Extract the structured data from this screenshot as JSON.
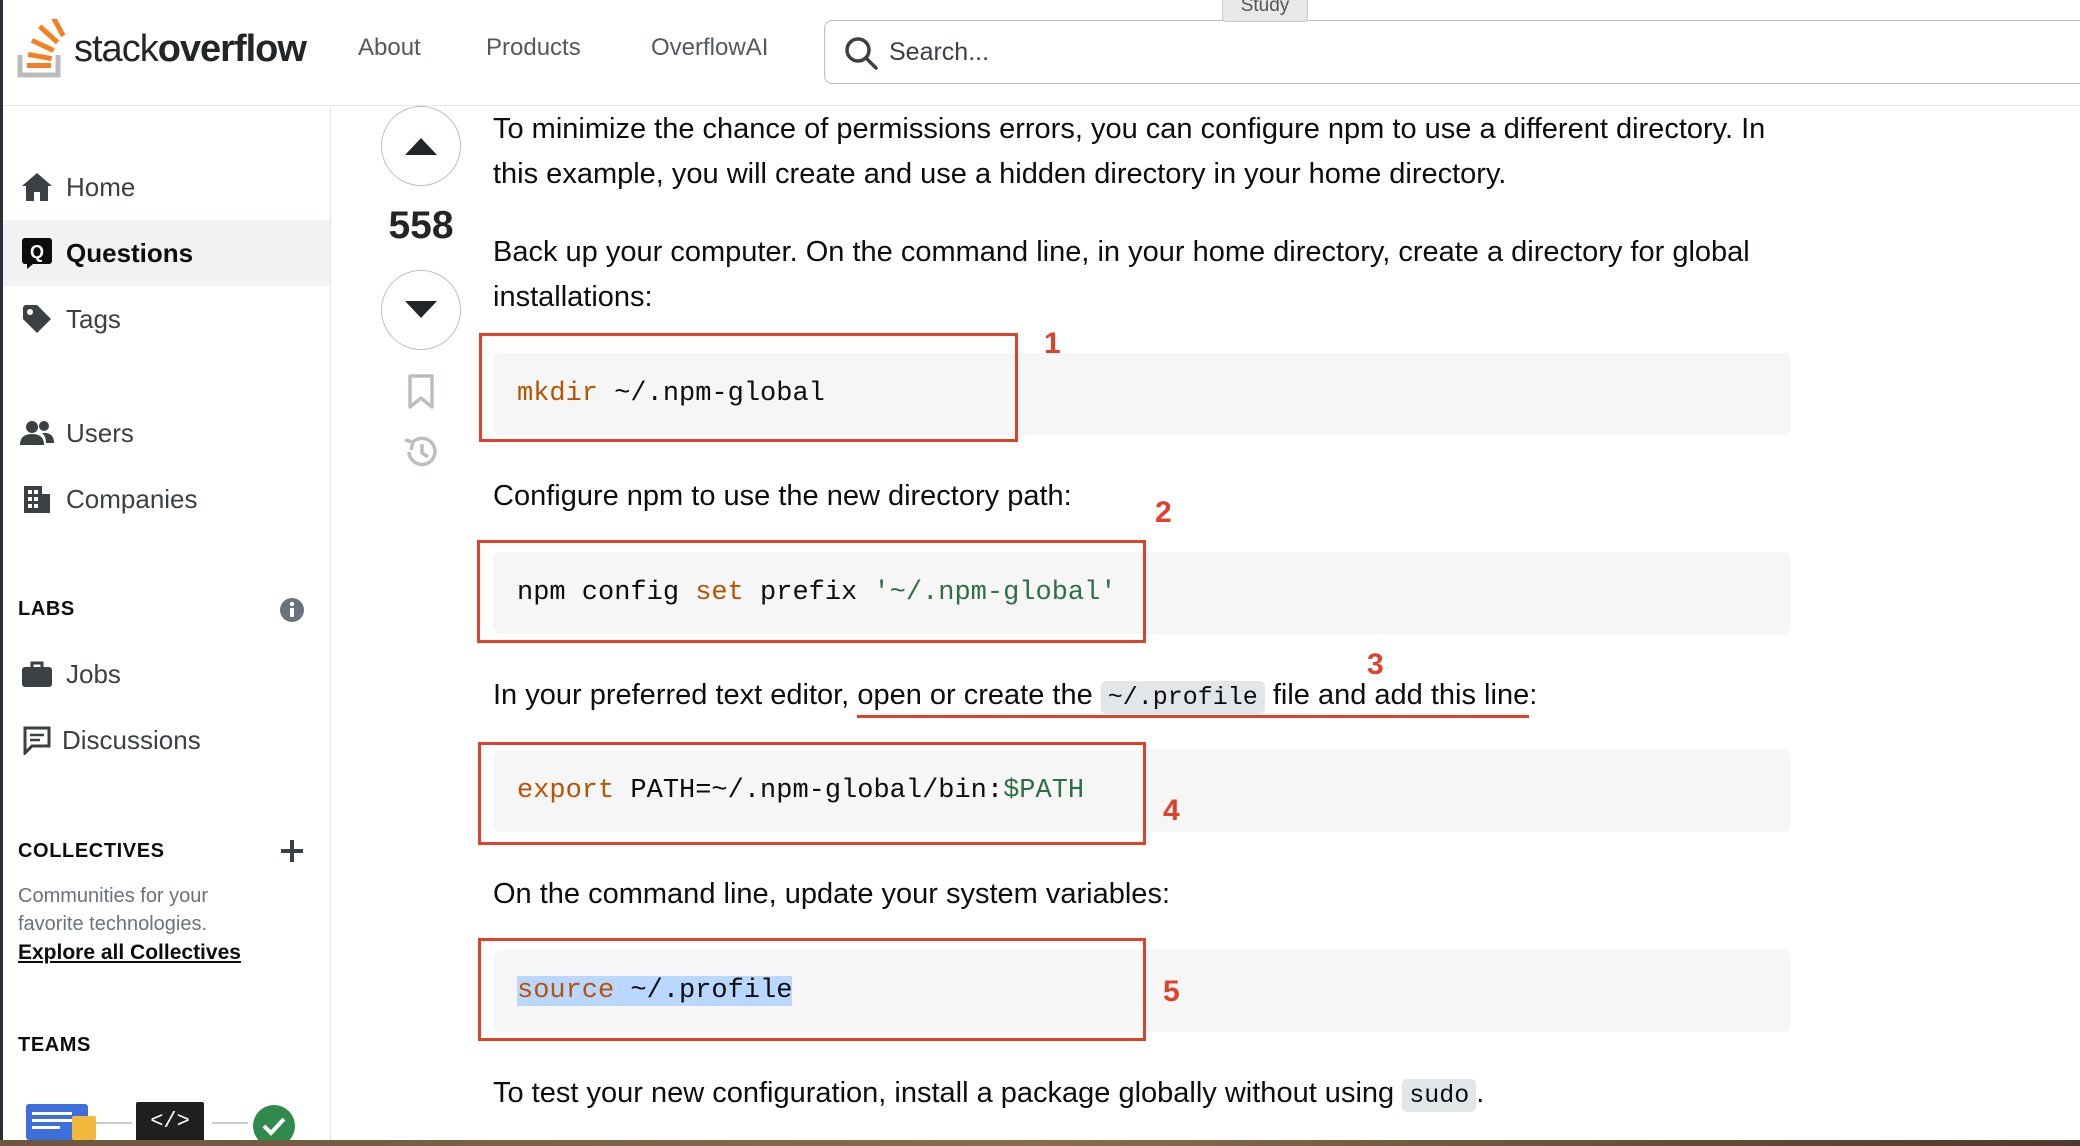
{
  "header": {
    "logo_text_light": "stack",
    "logo_text_bold": "overflow",
    "nav": [
      "About",
      "Products",
      "OverflowAI"
    ],
    "search_placeholder": "Search...",
    "tooltip": "Study"
  },
  "sidebar": {
    "items": [
      {
        "label": "Home",
        "icon": "home-icon"
      },
      {
        "label": "Questions",
        "icon": "questions-icon",
        "active": true
      },
      {
        "label": "Tags",
        "icon": "tag-icon"
      },
      {
        "label": "Users",
        "icon": "users-icon"
      },
      {
        "label": "Companies",
        "icon": "building-icon"
      }
    ],
    "labs_heading": "LABS",
    "labs_items": [
      "Jobs",
      "Discussions"
    ],
    "collectives_heading": "COLLECTIVES",
    "collectives_text": "Communities for your favorite technologies.",
    "collectives_link": "Explore all Collectives",
    "teams_heading": "TEAMS"
  },
  "vote": {
    "score": "558"
  },
  "post": {
    "p1": "To minimize the chance of permissions errors, you can configure npm to use a different directory. In this example, you will create and use a hidden directory in your home directory.",
    "p2": "Back up your computer. On the command line, in your home directory, create a directory for global installations:",
    "code1_kw": "mkdir",
    "code1_rest": " ~/.npm-global",
    "p3": "Configure npm to use the new directory path:",
    "code2_a": "npm config ",
    "code2_kw": "set",
    "code2_b": " prefix ",
    "code2_str": "'~/.npm-global'",
    "p4_a": "In your preferred text editor, ",
    "p4_b": "open or create the ",
    "p4_code": "~/.profile",
    "p4_c": " file and add this line",
    "p4_d": ":",
    "code3_kw": "export",
    "code3_rest": " PATH=~/.npm-global/bin:",
    "code3_var": "$PATH",
    "p5": "On the command line, update your system variables:",
    "code4_kw": "source",
    "code4_rest": " ~/.profile",
    "p6_a": "To test your new configuration, install a package globally without using ",
    "p6_code": "sudo",
    "p6_b": "."
  },
  "annotations": [
    "1",
    "2",
    "3",
    "4",
    "5"
  ],
  "colors": {
    "annotation": "#e0412a",
    "keyword": "#b75301",
    "string": "#2f6f44",
    "brand": "#f48024"
  }
}
